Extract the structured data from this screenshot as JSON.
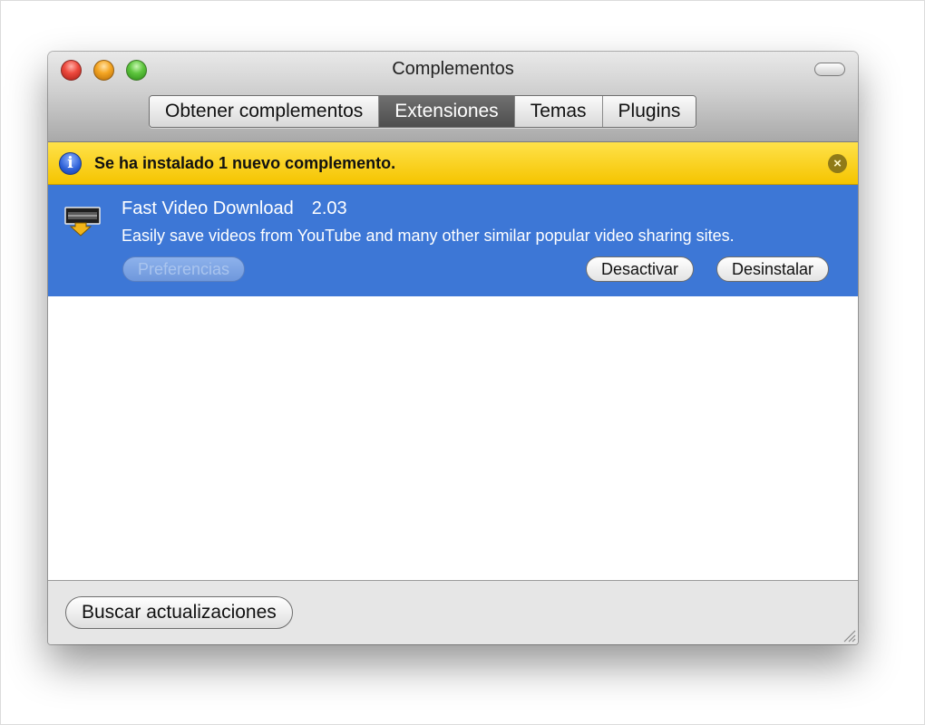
{
  "window": {
    "title": "Complementos"
  },
  "tabs": [
    {
      "label": "Obtener complementos",
      "active": false
    },
    {
      "label": "Extensiones",
      "active": true
    },
    {
      "label": "Temas",
      "active": false
    },
    {
      "label": "Plugins",
      "active": false
    }
  ],
  "notice": {
    "text": "Se ha instalado 1 nuevo complemento.",
    "icon": "info-icon",
    "close_icon": "close-circle-icon",
    "color": "#f5c400"
  },
  "addon": {
    "name": "Fast Video Download",
    "version": "2.03",
    "description": "Easily save videos from YouTube and many other similar popular video sharing sites.",
    "icon": "video-download-icon",
    "selection_color": "#3d77d6",
    "buttons": {
      "preferences": "Preferencias",
      "disable": "Desactivar",
      "uninstall": "Desinstalar"
    }
  },
  "footer": {
    "check_updates": "Buscar actualizaciones"
  }
}
